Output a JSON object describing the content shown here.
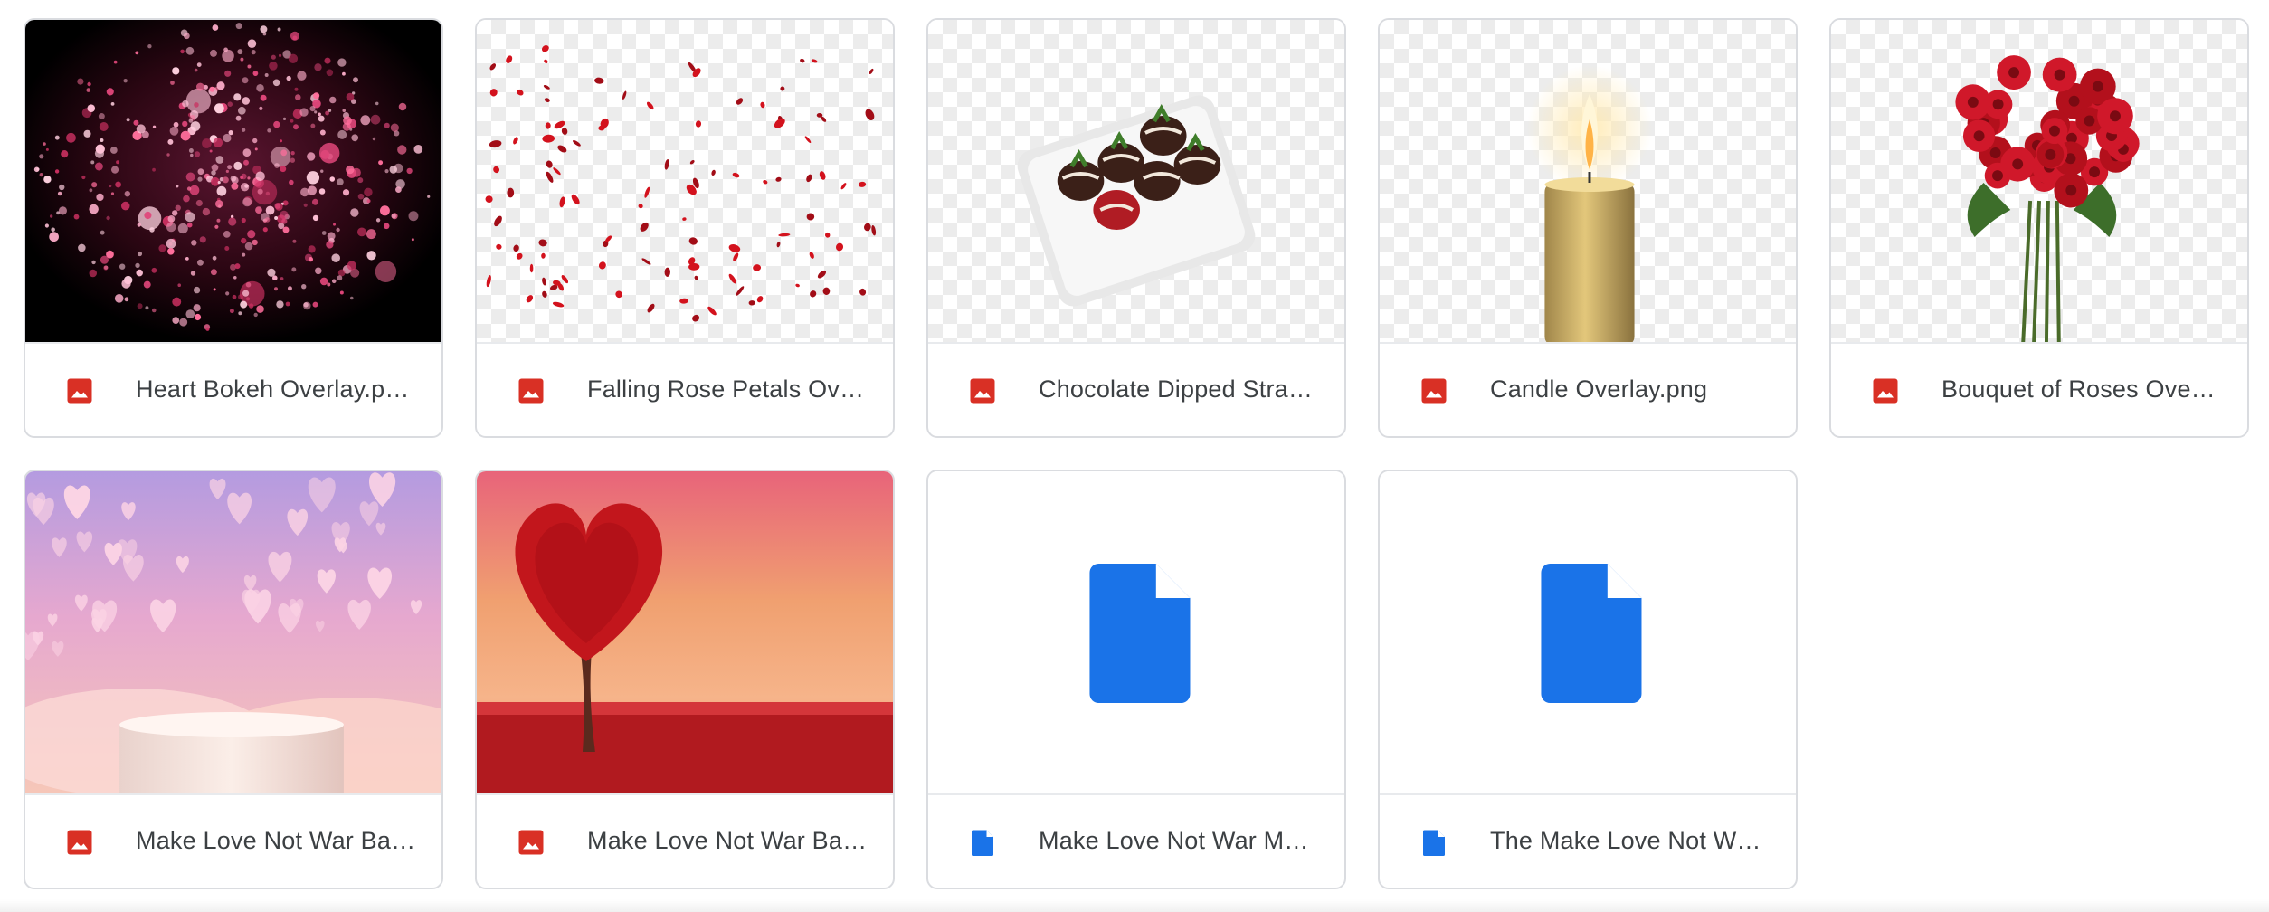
{
  "files": [
    {
      "name": "Heart Bokeh Overlay.p…",
      "type": "image",
      "thumbnail": "heart-bokeh"
    },
    {
      "name": "Falling Rose Petals Ov…",
      "type": "image",
      "thumbnail": "rose-petals"
    },
    {
      "name": "Chocolate Dipped Stra…",
      "type": "image",
      "thumbnail": "chocolate-strawberries"
    },
    {
      "name": "Candle Overlay.png",
      "type": "image",
      "thumbnail": "candle"
    },
    {
      "name": "Bouquet of Roses Over…",
      "type": "image",
      "thumbnail": "rose-bouquet"
    },
    {
      "name": "Make Love Not War Ba…",
      "type": "image",
      "thumbnail": "pink-hearts-backdrop"
    },
    {
      "name": "Make Love Not War Ba…",
      "type": "image",
      "thumbnail": "heart-tree"
    },
    {
      "name": "Make Love Not War M…",
      "type": "document",
      "thumbnail": "doc-icon"
    },
    {
      "name": "The Make Love Not W…",
      "type": "document",
      "thumbnail": "doc-icon"
    }
  ],
  "colors": {
    "image_icon": "#d93025",
    "doc_icon": "#1a73e8",
    "card_border": "#dadce0",
    "filename_text": "#3c4043"
  }
}
